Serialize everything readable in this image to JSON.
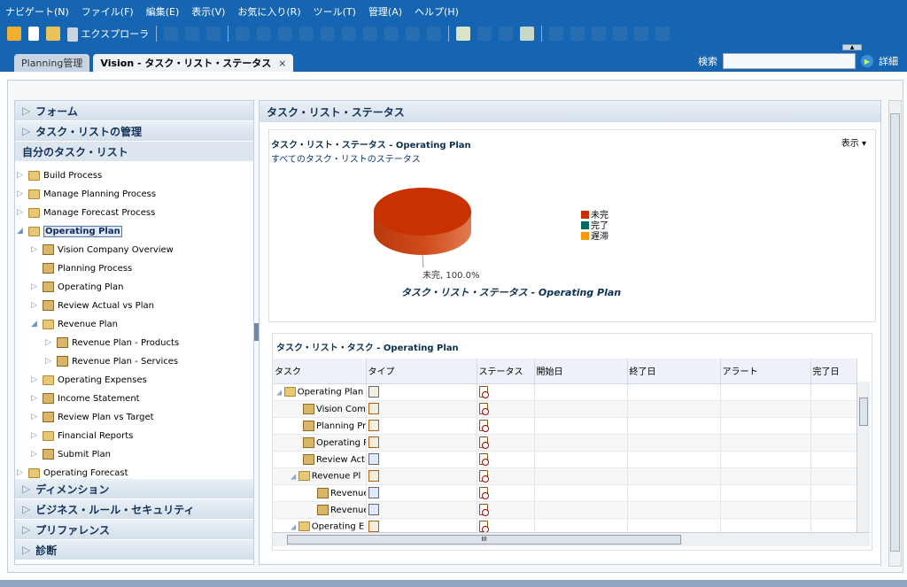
{
  "menu": [
    "ナビゲート(N)",
    "ファイル(F)",
    "編集(E)",
    "表示(V)",
    "お気に入り(R)",
    "ツール(T)",
    "管理(A)",
    "ヘルプ(H)"
  ],
  "toolbar": {
    "explorer_label": "エクスプローラ"
  },
  "tabs": [
    {
      "label": "Planning管理",
      "active": false
    },
    {
      "label": "Vision - タスク・リスト・ステータス",
      "active": true,
      "close": "×"
    }
  ],
  "search": {
    "label": "検索",
    "value": "",
    "detail_label": "詳細"
  },
  "left": {
    "top_sections": [
      "フォーム",
      "タスク・リストの管理"
    ],
    "open_section": "自分のタスク・リスト",
    "tree": [
      {
        "label": "Build Process",
        "level": 0,
        "icon": "folder",
        "arrow": "right"
      },
      {
        "label": "Manage Planning Process",
        "level": 0,
        "icon": "folder",
        "arrow": "right"
      },
      {
        "label": "Manage Forecast Process",
        "level": 0,
        "icon": "folder",
        "arrow": "right"
      },
      {
        "label": "Operating Plan",
        "level": 0,
        "icon": "folder",
        "arrow": "down",
        "selected": true
      },
      {
        "label": "Vision Company Overview",
        "level": 1,
        "icon": "cube",
        "arrow": "right"
      },
      {
        "label": "Planning Process",
        "level": 1,
        "icon": "cube",
        "arrow": ""
      },
      {
        "label": "Operating Plan",
        "level": 1,
        "icon": "cube",
        "arrow": "right"
      },
      {
        "label": "Review Actual vs Plan",
        "level": 1,
        "icon": "cube",
        "arrow": "right"
      },
      {
        "label": "Revenue Plan",
        "level": 1,
        "icon": "folder",
        "arrow": "down"
      },
      {
        "label": "Revenue Plan - Products",
        "level": 2,
        "icon": "cube",
        "arrow": "right"
      },
      {
        "label": "Revenue Plan - Services",
        "level": 2,
        "icon": "cube",
        "arrow": "right"
      },
      {
        "label": "Operating Expenses",
        "level": 1,
        "icon": "folder",
        "arrow": "right"
      },
      {
        "label": "Income Statement",
        "level": 1,
        "icon": "cube",
        "arrow": "right"
      },
      {
        "label": "Review Plan vs Target",
        "level": 1,
        "icon": "cube",
        "arrow": "right"
      },
      {
        "label": "Financial Reports",
        "level": 1,
        "icon": "folder",
        "arrow": "right"
      },
      {
        "label": "Submit Plan",
        "level": 1,
        "icon": "cube",
        "arrow": "right"
      },
      {
        "label": "Operating Forecast",
        "level": 0,
        "icon": "folder",
        "arrow": "right"
      }
    ],
    "bottom_sections": [
      "ディメンション",
      "ビジネス・ルール・セキュリティ",
      "プリファレンス",
      "診断"
    ]
  },
  "right": {
    "title": "タスク・リスト・ステータス",
    "chart_title": "タスク・リスト・ステータス - Operating Plan",
    "chart_subtitle": "すべてのタスク・リストのステータス",
    "view_label": "表示 ▾",
    "table_title": "タスク・リスト・タスク - Operating Plan"
  },
  "chart_data": {
    "type": "pie",
    "title": "タスク・リスト・ステータス - Operating Plan",
    "categories": [
      "未完",
      "完了",
      "遅滞"
    ],
    "values": [
      100.0,
      0,
      0
    ],
    "colors": [
      "#c83200",
      "#006b63",
      "#ff9900"
    ],
    "data_label": "未完, 100.0%",
    "legend": "right"
  },
  "table": {
    "columns": [
      "タスク",
      "タイプ",
      "ステータス",
      "開始日",
      "終了日",
      "アラート",
      "完了日"
    ],
    "rows": [
      {
        "task": "Operating Plan",
        "level": 0,
        "icon": "folder",
        "type": "group"
      },
      {
        "task": "Vision Comp",
        "level": 1,
        "icon": "cube",
        "type": "form"
      },
      {
        "task": "Planning Pro",
        "level": 1,
        "icon": "cube",
        "type": "form"
      },
      {
        "task": "Operating P",
        "level": 1,
        "icon": "cube",
        "type": "form"
      },
      {
        "task": "Review Actu",
        "level": 1,
        "icon": "cube",
        "type": "grid"
      },
      {
        "task": "Revenue Pl",
        "level": 1,
        "icon": "folder",
        "type": "form"
      },
      {
        "task": "Revenue",
        "level": 2,
        "icon": "cube",
        "type": "grid"
      },
      {
        "task": "Revenue",
        "level": 2,
        "icon": "cube",
        "type": "grid"
      },
      {
        "task": "Operating E",
        "level": 1,
        "icon": "folder",
        "type": "form"
      }
    ]
  }
}
